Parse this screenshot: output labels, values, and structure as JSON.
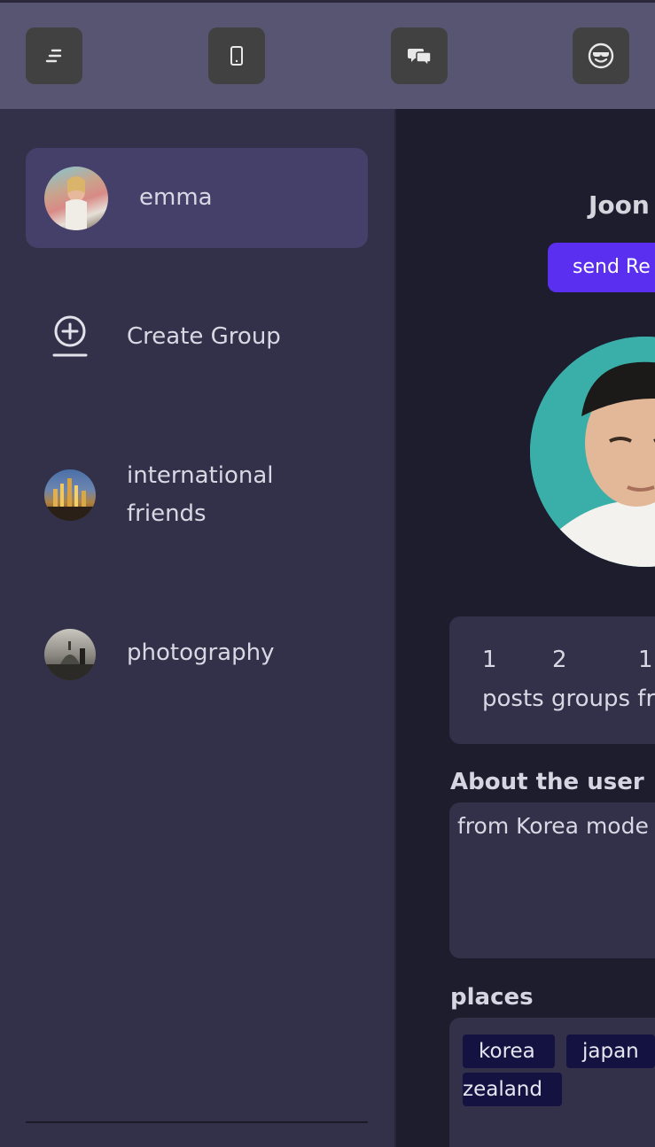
{
  "topbar": {
    "buttons": [
      {
        "icon": "menu-lines-icon"
      },
      {
        "icon": "phone-icon"
      },
      {
        "icon": "chat-bubbles-icon"
      },
      {
        "icon": "cool-smiley-icon"
      }
    ]
  },
  "sidebar": {
    "items": [
      {
        "label": "emma",
        "active": true
      },
      {
        "label": "Create Group",
        "icon": "add-circle-icon"
      },
      {
        "label_line1": "international",
        "label_line2": "friends"
      },
      {
        "label": "photography"
      }
    ]
  },
  "profile": {
    "name": "Joon",
    "send_button_label": "send Re",
    "stats": {
      "posts_count": "1",
      "groups_count": "2",
      "friends_count": "1",
      "labels": "posts groups fr"
    },
    "about_title": "About the user",
    "about_text": "from Korea mode",
    "places_title": "places",
    "places": [
      "korea",
      "japan",
      "zealand"
    ]
  },
  "colors": {
    "topbar": "#585573",
    "sidebar": "#333149",
    "active_item": "#44406a",
    "main_bg": "#1e1d2e",
    "accent": "#5a2ff0",
    "tag_bg": "#131241"
  }
}
